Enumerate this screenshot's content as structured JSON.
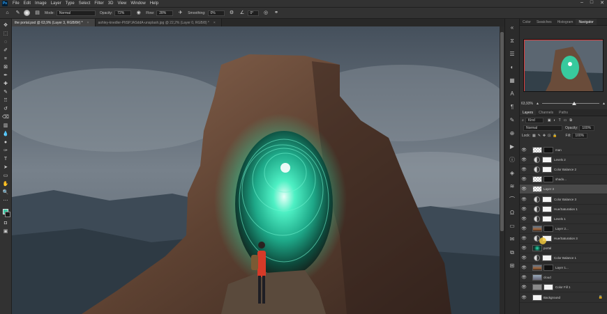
{
  "app": {
    "logo": "Ps",
    "menu": [
      "File",
      "Edit",
      "Image",
      "Layer",
      "Type",
      "Select",
      "Filter",
      "3D",
      "View",
      "Window",
      "Help"
    ],
    "window_controls": [
      "–",
      "□",
      "✕"
    ]
  },
  "options_bar": {
    "mode_label": "Mode:",
    "mode_value": "Normal",
    "opacity_label": "Opacity:",
    "opacity_value": "72%",
    "flow_label": "Flow:",
    "flow_value": "28%",
    "smoothing_label": "Smoothing:",
    "smoothing_value": "0%",
    "angle_value": "0°"
  },
  "tabs": [
    {
      "label": "the portal.psd @ 63,9% (Layer 3, RGB/8#) *",
      "active": true
    },
    {
      "label": "ashley-knedler-PItSPJASddA-unsplash.jpg @ 22,2% (Layer 0, RGB/8) *",
      "active": false
    }
  ],
  "top_panel_tabs": [
    "Color",
    "Swatches",
    "Histogram",
    "Navigator"
  ],
  "navigator": {
    "zoom": "63,93%"
  },
  "layers_panel": {
    "tabs": [
      "Layers",
      "Channels",
      "Paths"
    ],
    "filter_value": "Kind",
    "blend_mode": "Normal",
    "opacity_label": "Opacity:",
    "opacity_value": "100%",
    "lock_label": "Lock:",
    "fill_label": "Fill:",
    "fill_value": "100%",
    "layers": [
      {
        "name": "man",
        "thumb": "checker",
        "mask": "black",
        "type": "pixel"
      },
      {
        "name": "Levels 2",
        "type": "adj",
        "mask": "white"
      },
      {
        "name": "Color Balance 2",
        "type": "adj",
        "mask": "white"
      },
      {
        "name": "shado...",
        "thumb": "checker",
        "mask": "black",
        "type": "pixel"
      },
      {
        "name": "Layer 3",
        "thumb": "checker",
        "type": "pixel",
        "selected": true
      },
      {
        "name": "Color Balance 3",
        "type": "adj",
        "mask": "white"
      },
      {
        "name": "Hue/Saturation 1",
        "type": "adj",
        "mask": "white"
      },
      {
        "name": "Levels 1",
        "type": "adj",
        "mask": "white"
      },
      {
        "name": "Layer 2...",
        "thumb": "photo",
        "mask": "black",
        "type": "pixel"
      },
      {
        "name": "Hue/Saturation 3",
        "type": "adj",
        "mask": "white"
      },
      {
        "name": "portal",
        "thumb": "portal",
        "type": "pixel"
      },
      {
        "name": "Color Balance 1",
        "type": "adj",
        "mask": "white"
      },
      {
        "name": "Layer 1...",
        "thumb": "photo",
        "mask": "black",
        "type": "pixel"
      },
      {
        "name": "cloud",
        "thumb": "cloud",
        "type": "pixel"
      },
      {
        "name": "Color Fill 1",
        "thumb": "gray",
        "mask": "white",
        "type": "fill"
      },
      {
        "name": "Background",
        "thumb": "white",
        "type": "pixel",
        "locked": true
      }
    ]
  },
  "colors": {
    "foreground": "#3ec8a4",
    "background": "#1a1a1a",
    "portal_glow": "#2fe0b0"
  }
}
